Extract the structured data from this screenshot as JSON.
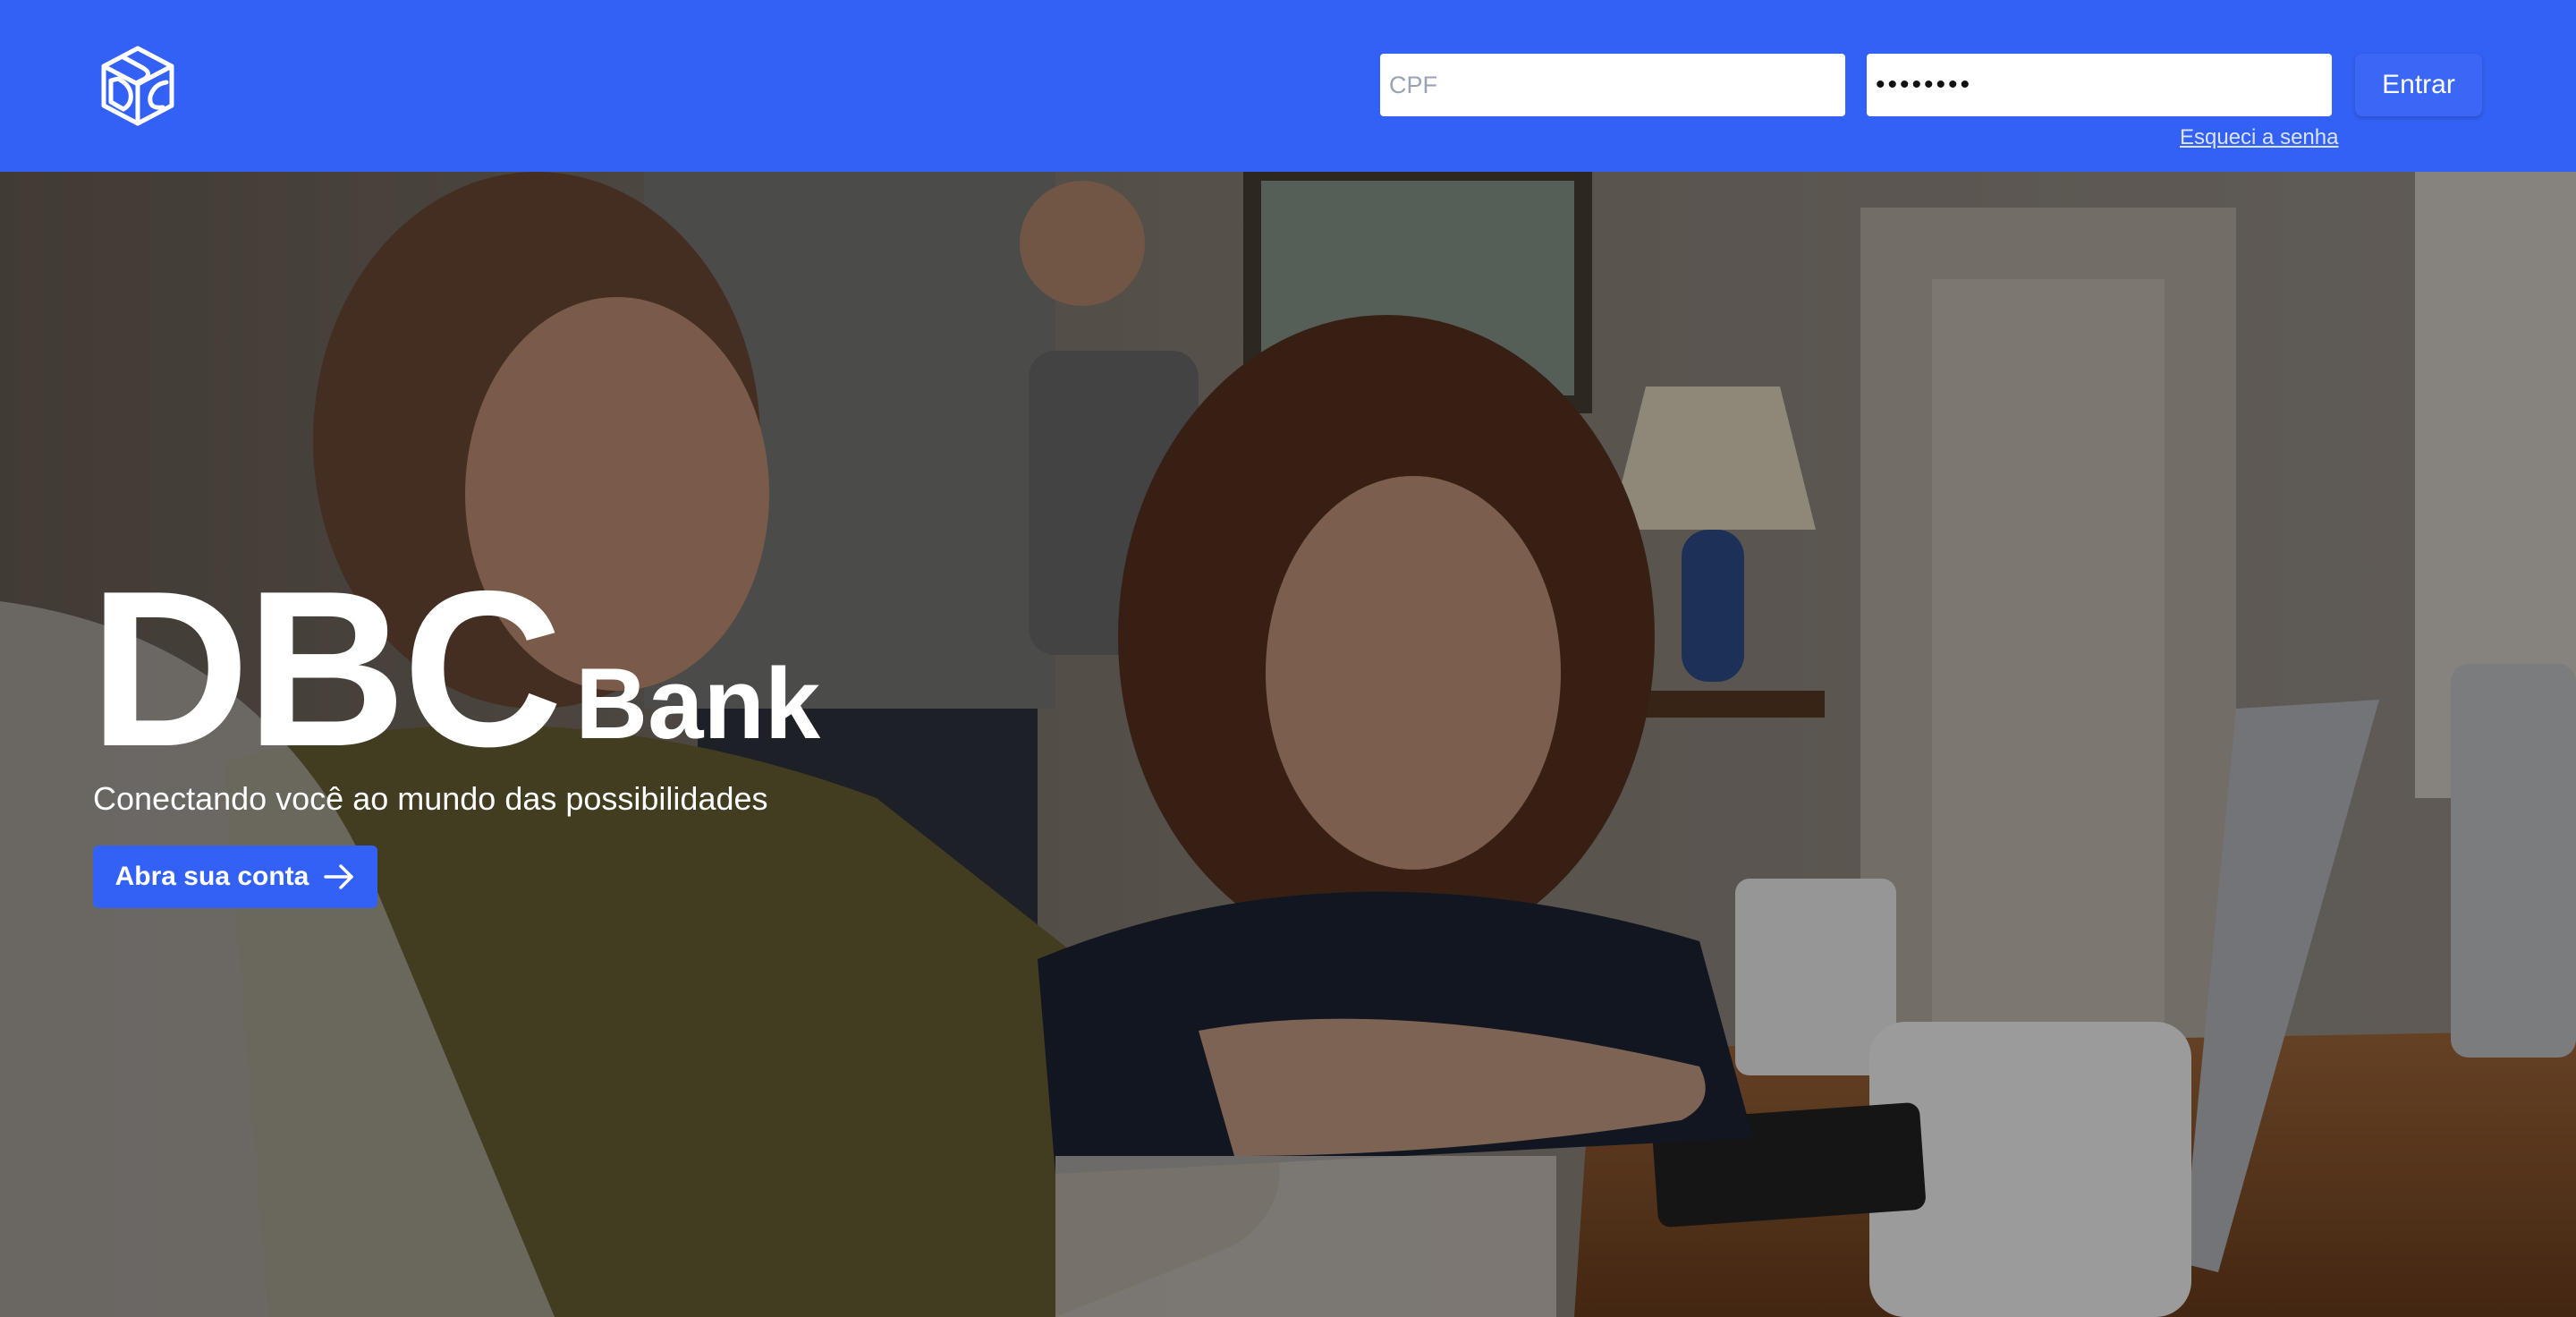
{
  "header": {
    "logo_icon": "dbc-cube-logo-icon",
    "cpf_placeholder": "CPF",
    "password_value": "••••••••",
    "forgot_password": "Esqueci a senha",
    "login_button": "Entrar"
  },
  "hero": {
    "brand_big": "DBC",
    "brand_small": "Bank",
    "tagline": "Conectando você ao mundo das possibilidades",
    "cta_label": "Abra sua conta",
    "cta_icon": "arrow-right-icon"
  },
  "colors": {
    "primary": "#3461f5",
    "text_on_primary": "#ffffff"
  }
}
